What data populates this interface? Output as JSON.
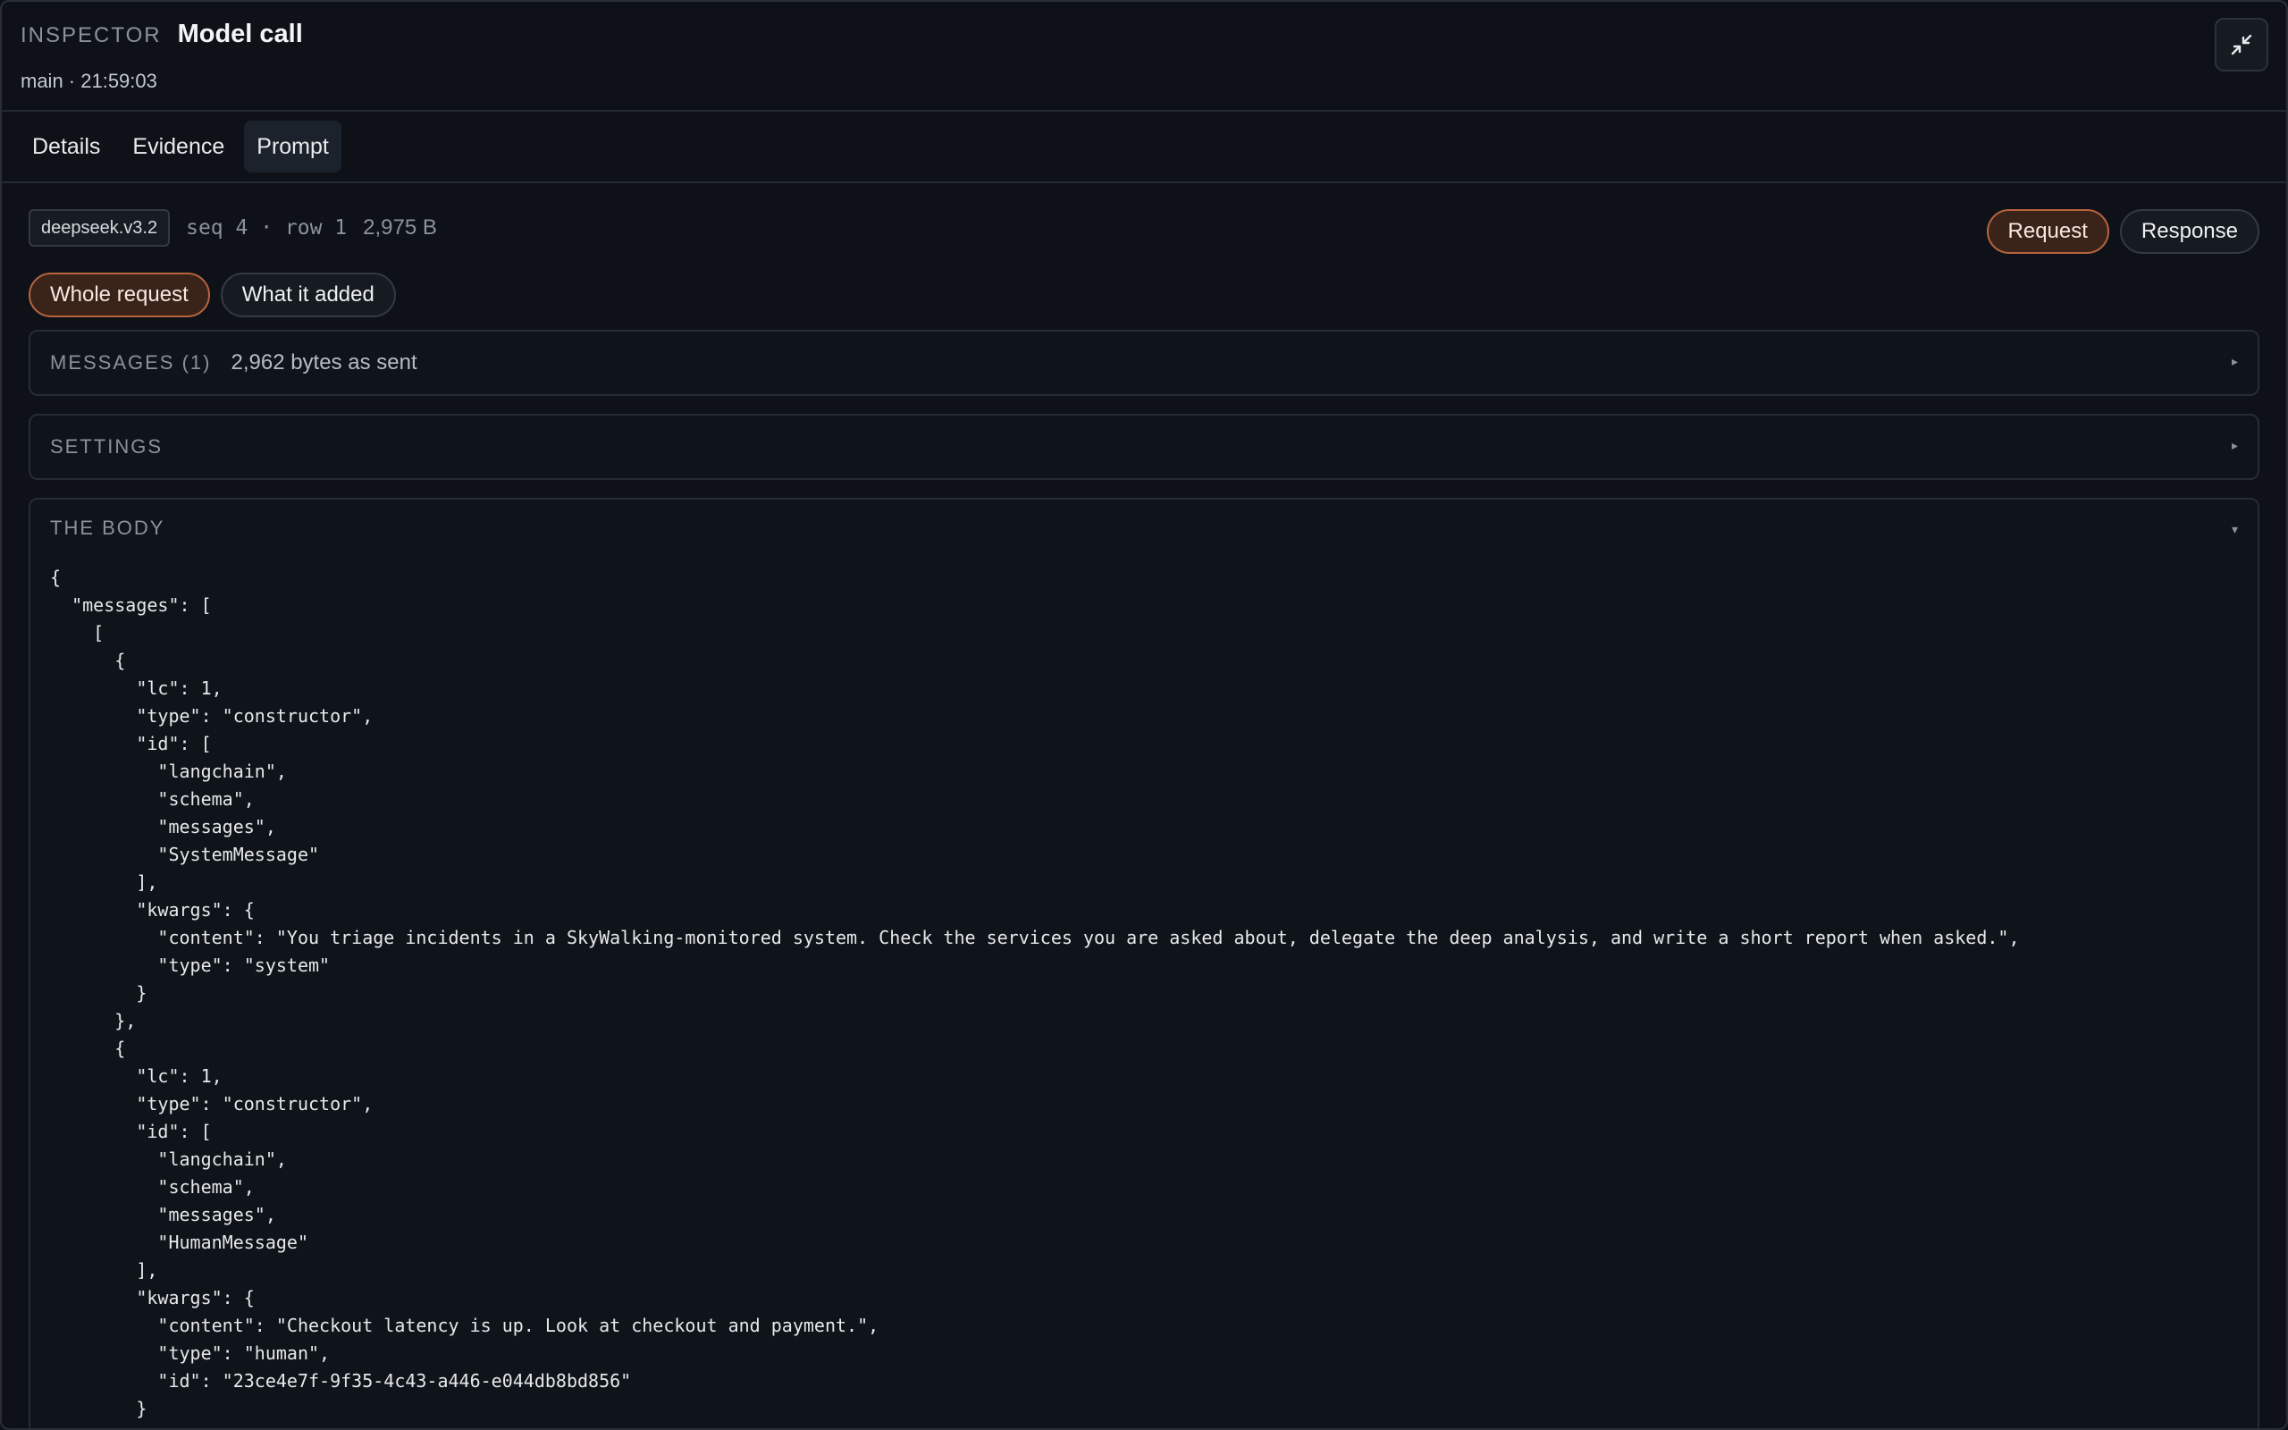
{
  "header": {
    "eyebrow": "INSPECTOR",
    "title": "Model call",
    "subtitle": "main · 21:59:03"
  },
  "tabs": [
    {
      "label": "Details"
    },
    {
      "label": "Evidence"
    },
    {
      "label": "Prompt"
    }
  ],
  "meta": {
    "model": "deepseek.v3.2",
    "seq": "seq 4 · row 1",
    "size": "2,975 B"
  },
  "view_toggle": {
    "request": "Request",
    "response": "Response"
  },
  "scope_toggle": {
    "whole": "Whole request",
    "added": "What it added"
  },
  "sections": {
    "messages": {
      "label": "MESSAGES (1)",
      "extra": "2,962 bytes as sent",
      "caret": "▸"
    },
    "settings": {
      "label": "SETTINGS",
      "caret": "▸"
    },
    "body": {
      "label": "THE BODY",
      "caret": "▾",
      "json": "{\n  \"messages\": [\n    [\n      {\n        \"lc\": 1,\n        \"type\": \"constructor\",\n        \"id\": [\n          \"langchain\",\n          \"schema\",\n          \"messages\",\n          \"SystemMessage\"\n        ],\n        \"kwargs\": {\n          \"content\": \"You triage incidents in a SkyWalking-monitored system. Check the services you are asked about, delegate the deep analysis, and write a short report when asked.\",\n          \"type\": \"system\"\n        }\n      },\n      {\n        \"lc\": 1,\n        \"type\": \"constructor\",\n        \"id\": [\n          \"langchain\",\n          \"schema\",\n          \"messages\",\n          \"HumanMessage\"\n        ],\n        \"kwargs\": {\n          \"content\": \"Checkout latency is up. Look at checkout and payment.\",\n          \"type\": \"human\",\n          \"id\": \"23ce4e7f-9f35-4c43-a446-e044db8bd856\"\n        }"
    }
  },
  "icons": {
    "collapse": "collapse-arrows-icon"
  }
}
